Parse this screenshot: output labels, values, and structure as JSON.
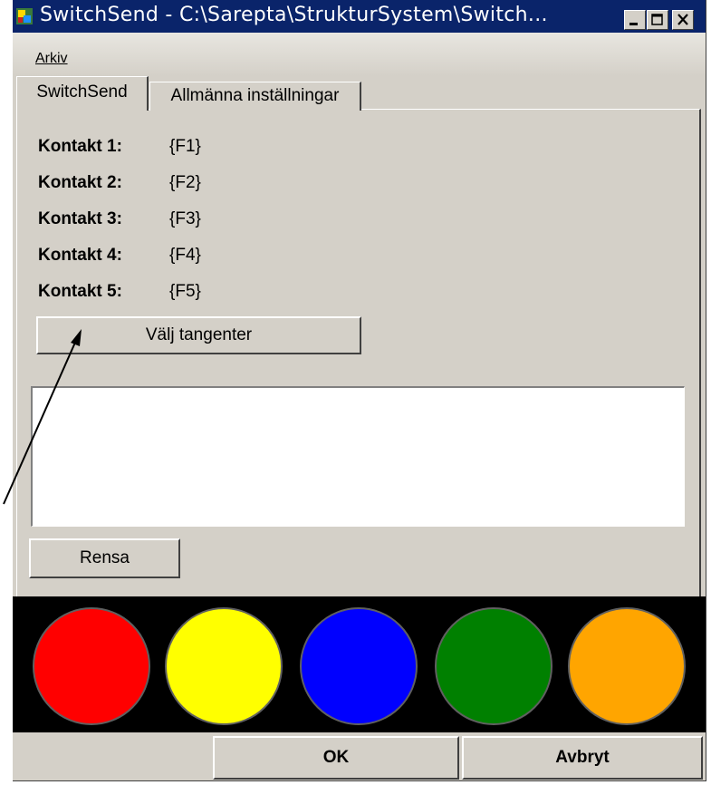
{
  "window": {
    "title": "SwitchSend - C:\\Sarepta\\StrukturSystem\\Switch..."
  },
  "menu": {
    "items": [
      {
        "label": "Arkiv"
      }
    ]
  },
  "tabs": [
    {
      "label": "SwitchSend",
      "active": true
    },
    {
      "label": "Allmänna inställningar",
      "active": false
    }
  ],
  "contacts": [
    {
      "label": "Kontakt 1:",
      "value": "{F1}"
    },
    {
      "label": "Kontakt 2:",
      "value": "{F2}"
    },
    {
      "label": "Kontakt 3:",
      "value": "{F3}"
    },
    {
      "label": "Kontakt 4:",
      "value": "{F4}"
    },
    {
      "label": "Kontakt 5:",
      "value": "{F5}"
    }
  ],
  "buttons": {
    "choose_keys": "Välj tangenter",
    "clear": "Rensa",
    "ok": "OK",
    "cancel": "Avbryt"
  },
  "text_area": {
    "value": ""
  },
  "switch_colors": [
    "#ff0000",
    "#ffff00",
    "#0000ff",
    "#008000",
    "#ffa500"
  ],
  "icons": [
    "app-icon",
    "minimize-icon",
    "maximize-icon",
    "close-icon"
  ]
}
